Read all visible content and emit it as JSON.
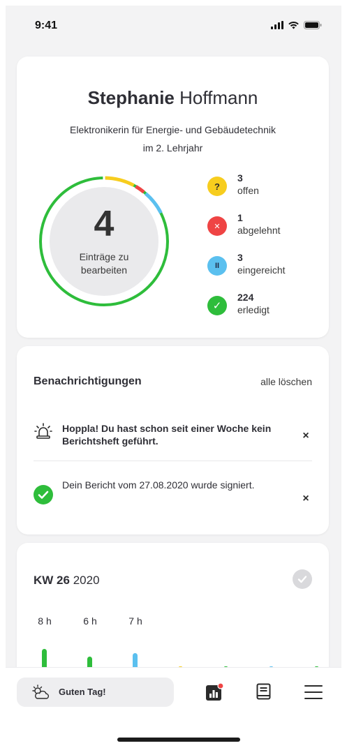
{
  "status_bar": {
    "time": "9:41",
    "icons": [
      "signal-icon",
      "wifi-icon",
      "battery-icon"
    ]
  },
  "profile": {
    "first_name": "Stephanie",
    "last_name": "Hoffmann",
    "role_line1": "Elektronikerin für Energie- und Gebäudetechnik",
    "role_line2": "im 2. Lehrjahr",
    "open_entries_count": "4",
    "open_entries_label_line1": "Einträge zu",
    "open_entries_label_line2": "bearbeiten",
    "legend": [
      {
        "count": "3",
        "label": "offen",
        "icon": "question-icon",
        "glyph": "?",
        "color": "#f7cd1e"
      },
      {
        "count": "1",
        "label": "abgelehnt",
        "icon": "x-icon",
        "glyph": "✕",
        "color": "#ef4444"
      },
      {
        "count": "3",
        "label": "eingereicht",
        "icon": "pause-icon",
        "glyph": "II",
        "color": "#5bc0ef"
      },
      {
        "count": "224",
        "label": "erledigt",
        "icon": "check-icon",
        "glyph": "✓",
        "color": "#2ebd3b"
      }
    ]
  },
  "notifications": {
    "title": "Benachrichtigungen",
    "clear_all": "alle löschen",
    "items": [
      {
        "icon": "alarm-light-icon",
        "text": "Hoppla! Du hast schon seit einer Woche kein Berichtsheft geführt.",
        "bold": true,
        "close": "×"
      },
      {
        "icon": "check-circle-icon",
        "text": "Dein Bericht vom 27.08.2020 wurde signiert.",
        "bold": false,
        "close": "×"
      }
    ]
  },
  "week": {
    "kw_label": "KW 26",
    "year": "2020",
    "days": [
      {
        "label": "8 h",
        "hours": 8,
        "color": "#2ebd3b"
      },
      {
        "label": "6 h",
        "hours": 6,
        "color": "#2ebd3b"
      },
      {
        "label": "7 h",
        "hours": 7,
        "color": "#5bc0ef"
      },
      {
        "label": "",
        "hours": 0,
        "color": "#f7cd1e"
      },
      {
        "label": "",
        "hours": 0,
        "color": "#2ebd3b"
      },
      {
        "label": "",
        "hours": 0,
        "color": "#5bc0ef"
      },
      {
        "label": "",
        "hours": 0,
        "color": "#2ebd3b"
      }
    ]
  },
  "tab_bar": {
    "greeting": "Guten Tag!",
    "tabs": [
      "stats-icon",
      "book-icon",
      "menu-icon"
    ]
  },
  "colors": {
    "green": "#2ebd3b",
    "yellow": "#f7cd1e",
    "red": "#ef4444",
    "blue": "#5bc0ef"
  }
}
